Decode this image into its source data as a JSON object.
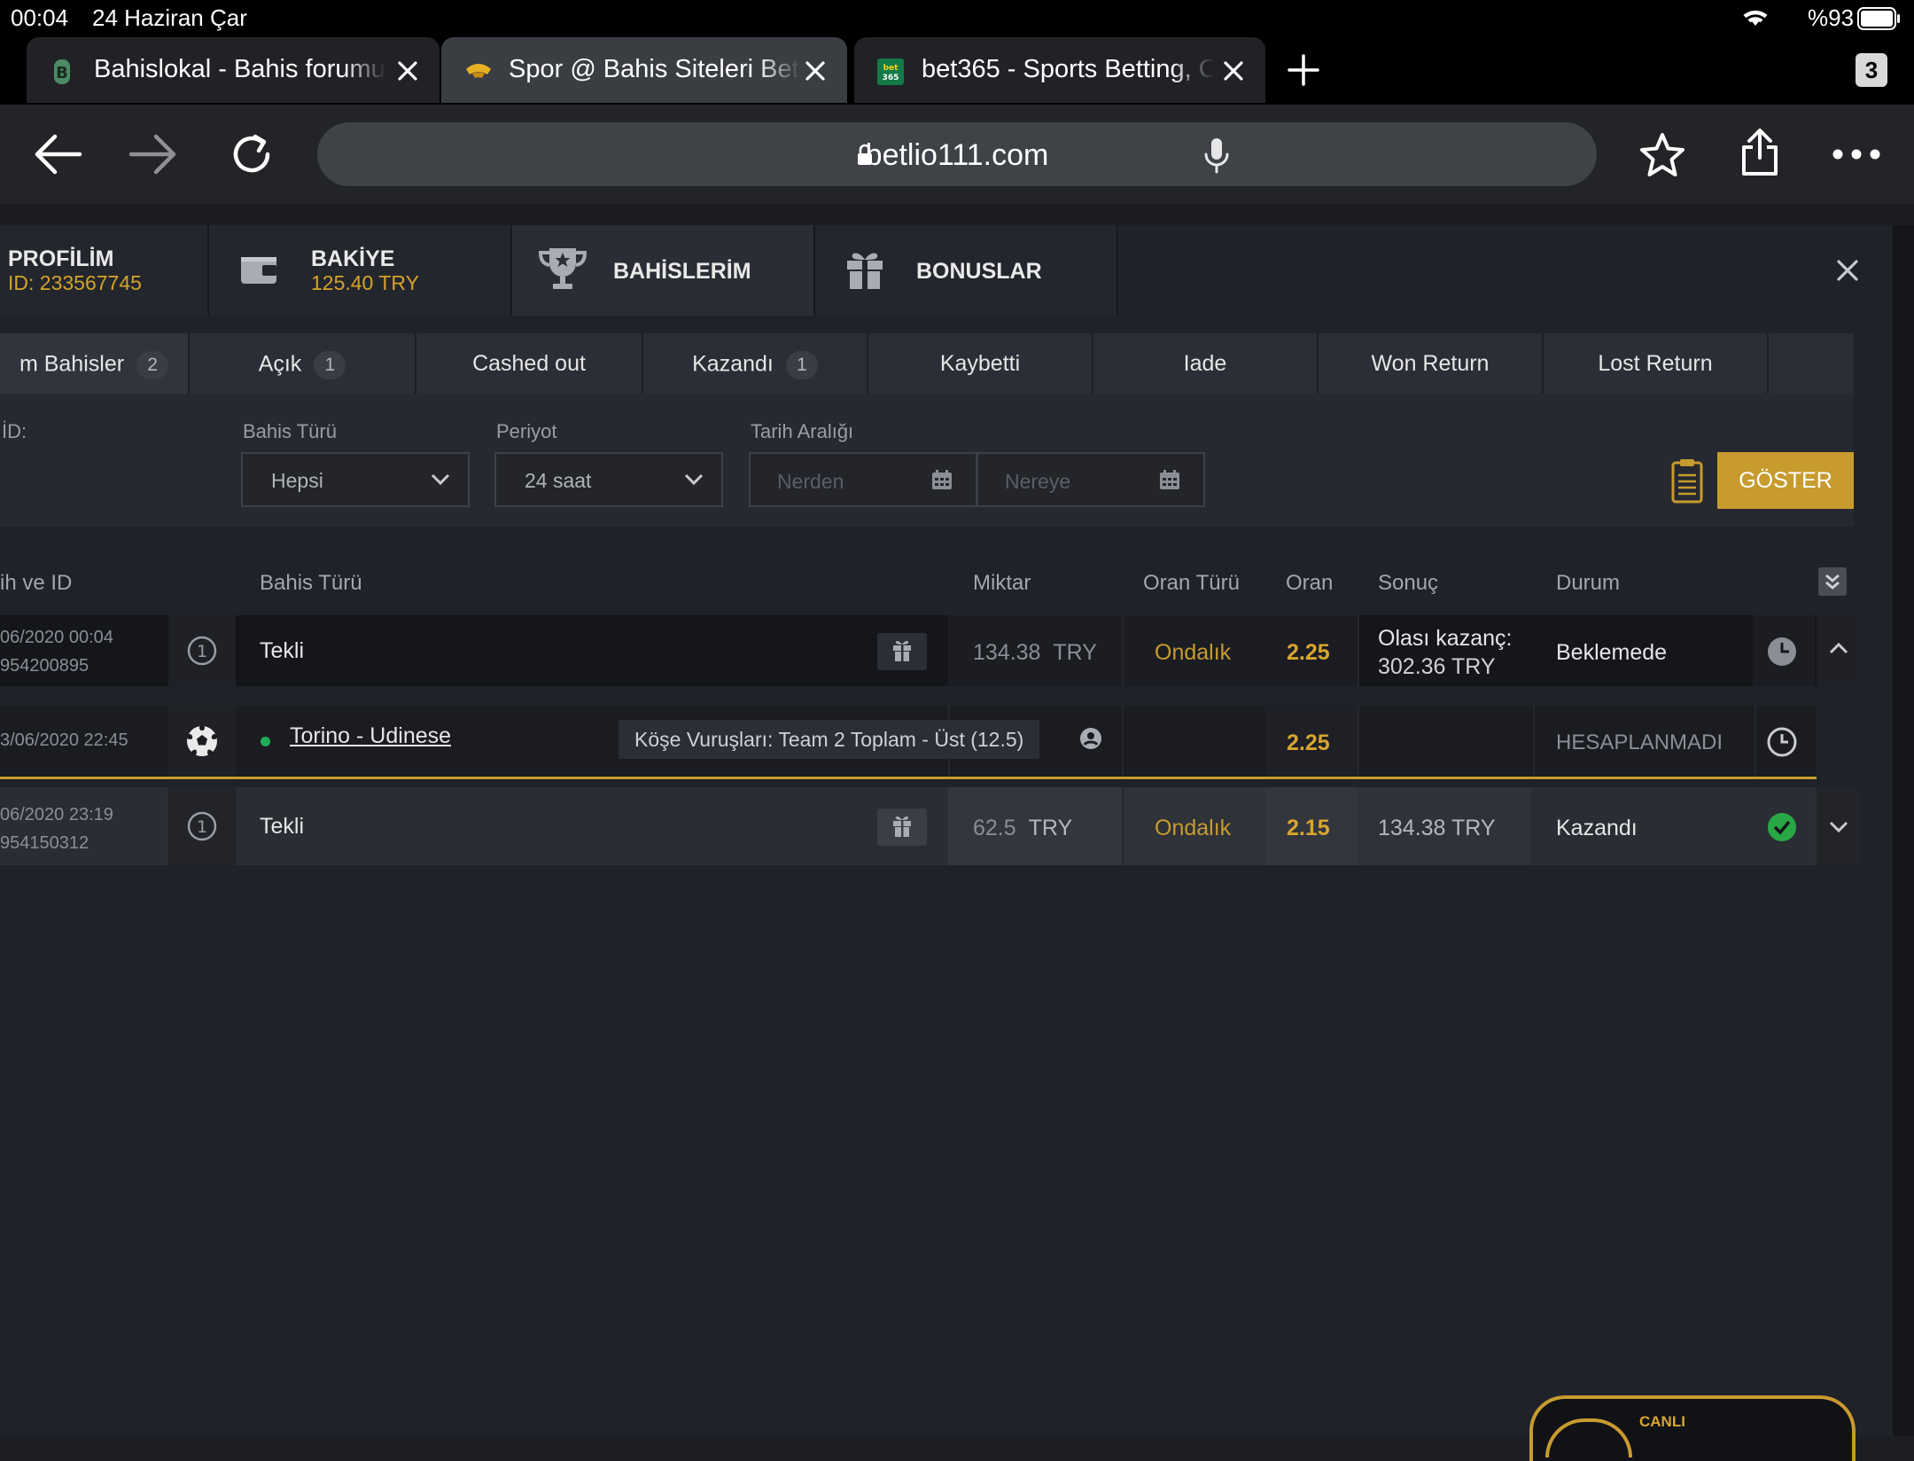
{
  "status_bar": {
    "time": "00:04",
    "date": "24 Haziran Çar",
    "battery": "%93"
  },
  "browser": {
    "tabs": [
      {
        "title": "Bahislokal - Bahis forumu",
        "active": false
      },
      {
        "title": "Spor @ Bahis Siteleri Bet",
        "active": true
      },
      {
        "title": "bet365 - Sports Betting, C",
        "active": false
      }
    ],
    "tab_count": "3",
    "url": "betlio111.com"
  },
  "account": {
    "profile": {
      "title": "PROFİLİM",
      "id": "ID: 233567745"
    },
    "balance": {
      "title": "BAKİYE",
      "amount": "125.40 TRY"
    },
    "bets": {
      "title": "BAHİSLERİM"
    },
    "bonuses": {
      "title": "BONUSLAR"
    }
  },
  "bet_tabs": [
    {
      "label": "m Bahisler",
      "count": "2"
    },
    {
      "label": "Açık",
      "count": "1"
    },
    {
      "label": "Cashed out",
      "count": ""
    },
    {
      "label": "Kazandı",
      "count": "1"
    },
    {
      "label": "Kaybetti",
      "count": ""
    },
    {
      "label": "Iade",
      "count": ""
    },
    {
      "label": "Won Return",
      "count": ""
    },
    {
      "label": "Lost Return",
      "count": ""
    }
  ],
  "filters": {
    "id_label": "İD:",
    "bet_type_label": "Bahis Türü",
    "bet_type_value": "Hepsi",
    "period_label": "Periyot",
    "period_value": "24 saat",
    "date_range_label": "Tarih Aralığı",
    "from_placeholder": "Nerden",
    "to_placeholder": "Nereye",
    "show_button": "GÖSTER"
  },
  "table": {
    "headers": {
      "date_id": "ih ve ID",
      "bet_type": "Bahis Türü",
      "amount": "Miktar",
      "odds_type": "Oran Türü",
      "odds": "Oran",
      "result": "Sonuç",
      "status": "Durum"
    },
    "rows": [
      {
        "date": "06/2020 00:04",
        "id": "954200895",
        "type_number": "1",
        "bet_type": "Tekli",
        "amount": "134.38",
        "currency": "TRY",
        "odds_type": "Ondalık",
        "odds": "2.25",
        "result_line1": "Olası kazanç:",
        "result_amount": "302.36",
        "result_currency": "TRY",
        "status": "Beklemede"
      },
      {
        "date": "06/2020 23:19",
        "id": "954150312",
        "type_number": "1",
        "bet_type": "Tekli",
        "amount": "62.5",
        "currency": "TRY",
        "odds_type": "Ondalık",
        "odds": "2.15",
        "result_amount": "134.38",
        "result_currency": "TRY",
        "status": "Kazandı"
      }
    ],
    "selection": {
      "date": "3/06/2020 22:45",
      "match": "Torino - Udinese",
      "market": "Köşe Vuruşları: Team 2 Toplam - Üst (12.5)",
      "odds": "2.25",
      "status": "HESAPLANMADI"
    }
  },
  "live_badge": "CANLI",
  "colors": {
    "accent": "#c89b2e",
    "odds": "#d8a62d",
    "win": "#28a745",
    "live_dot": "#1fae5a"
  }
}
